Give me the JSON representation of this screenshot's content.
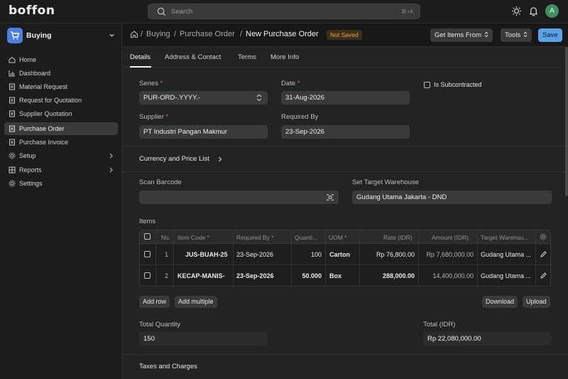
{
  "app": {
    "logo": "boffon",
    "avatar_initial": "A"
  },
  "search": {
    "placeholder": "Search",
    "shortcut": "⌘+K"
  },
  "sidebar": {
    "workspace": "Buying",
    "items": [
      {
        "label": "Home",
        "icon": "home-icon"
      },
      {
        "label": "Dashboard",
        "icon": "bar-chart-icon"
      },
      {
        "label": "Material Request",
        "icon": "file-icon"
      },
      {
        "label": "Request for Quotation",
        "icon": "file-icon"
      },
      {
        "label": "Supplier Quotation",
        "icon": "file-icon"
      },
      {
        "label": "Purchase Order",
        "icon": "file-icon",
        "active": true
      },
      {
        "label": "Purchase Invoice",
        "icon": "file-icon"
      },
      {
        "label": "Setup",
        "icon": "gear-icon",
        "has_children": true
      },
      {
        "label": "Reports",
        "icon": "report-icon",
        "has_children": true
      },
      {
        "label": "Settings",
        "icon": "gear-icon"
      }
    ]
  },
  "breadcrumb": {
    "sep": "/",
    "items": [
      "Buying",
      "Purchase Order"
    ],
    "current": "New Purchase Order"
  },
  "status_badge": "Not Saved",
  "actions": {
    "get_items": "Get Items From",
    "tools": "Tools",
    "save": "Save"
  },
  "tabs": [
    "Details",
    "Address & Contact",
    "Terms",
    "More Info"
  ],
  "form": {
    "series_label": "Series",
    "series_value": "PUR-ORD-.YYYY.-",
    "date_label": "Date",
    "date_value": "31-Aug-2026",
    "subcontracted_label": "Is Subcontracted",
    "supplier_label": "Supplier",
    "supplier_value": "PT Industri Pangan Makmur",
    "required_by_label": "Required By",
    "required_by_value": "23-Sep-2026",
    "currency_section": "Currency and Price List",
    "barcode_label": "Scan Barcode",
    "barcode_value": "",
    "warehouse_label": "Set Target Warehouse",
    "warehouse_value": "Gudang Utama Jakarta - DND",
    "required_mark": "*"
  },
  "items": {
    "title": "Items",
    "columns": [
      "No.",
      "Item Code",
      "Required By",
      "Quanti...",
      "UOM",
      "Rate (IDR)",
      "Amount (IDR)",
      "Target Warehou..."
    ],
    "rows": [
      {
        "no": "1",
        "item_code": "JUS-BUAH-25",
        "required_by": "23-Sep-2026",
        "qty": "100",
        "uom": "Carton",
        "rate": "Rp 76,800.00",
        "amount": "Rp 7,680,000.00",
        "warehouse": "Gudang Utama ..."
      },
      {
        "no": "2",
        "item_code": "KECAP-MANIS-",
        "required_by": "23-Sep-2026",
        "qty": "50.000",
        "uom": "Box",
        "rate": "288,000.00",
        "amount": "14,400,000.00",
        "warehouse": "Gudang Utama ..."
      }
    ],
    "add_row": "Add row",
    "add_multiple": "Add multiple",
    "download": "Download",
    "upload": "Upload"
  },
  "totals": {
    "qty_label": "Total Quantity",
    "qty_value": "150",
    "total_label": "Total (IDR)",
    "total_value": "Rp 22,080,000.00"
  },
  "taxes_section": "Taxes and Charges",
  "colors": {
    "accent": "#5aa2e8",
    "badge_text": "#e7a24a",
    "required": "#e0644e",
    "app_icon": "#4a7ee0"
  }
}
